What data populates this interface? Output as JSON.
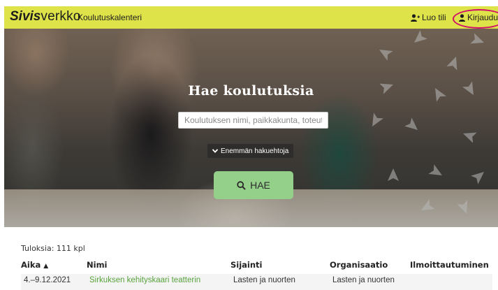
{
  "header": {
    "brand_bold": "Sivis",
    "brand_rest": "verkko",
    "subtitle": "Koulutuskalenteri",
    "register_label": "Luo tili",
    "login_label": "Kirjaudu",
    "background_color": "#dfe34a",
    "highlight_color": "#d10d6b",
    "icons": {
      "register": "user-plus-icon",
      "login": "user-icon"
    }
  },
  "hero": {
    "title": "Hae koulutuksia",
    "search_placeholder": "Koulutuksen nimi, paikkakunta, toteuttaja",
    "more_options_label": "Enemmän hakuehtoja",
    "search_button_label": "HAE",
    "search_button_color": "#94d08a",
    "icons": {
      "more_options": "chevron-down-icon",
      "search": "search-icon"
    }
  },
  "results": {
    "count_text": "Tuloksia: 111 kpl",
    "columns": [
      "Aika",
      "Nimi",
      "Sijainti",
      "Organisaatio",
      "Ilmoittautuminen"
    ],
    "sort_indicator": "▲",
    "rows": [
      [
        "4.–9.12.2021",
        "Sirkuksen kehityskaari teatterin",
        "Lasten ja nuorten",
        "Lasten ja nuorten",
        ""
      ]
    ],
    "link_color": "#58a23d"
  }
}
